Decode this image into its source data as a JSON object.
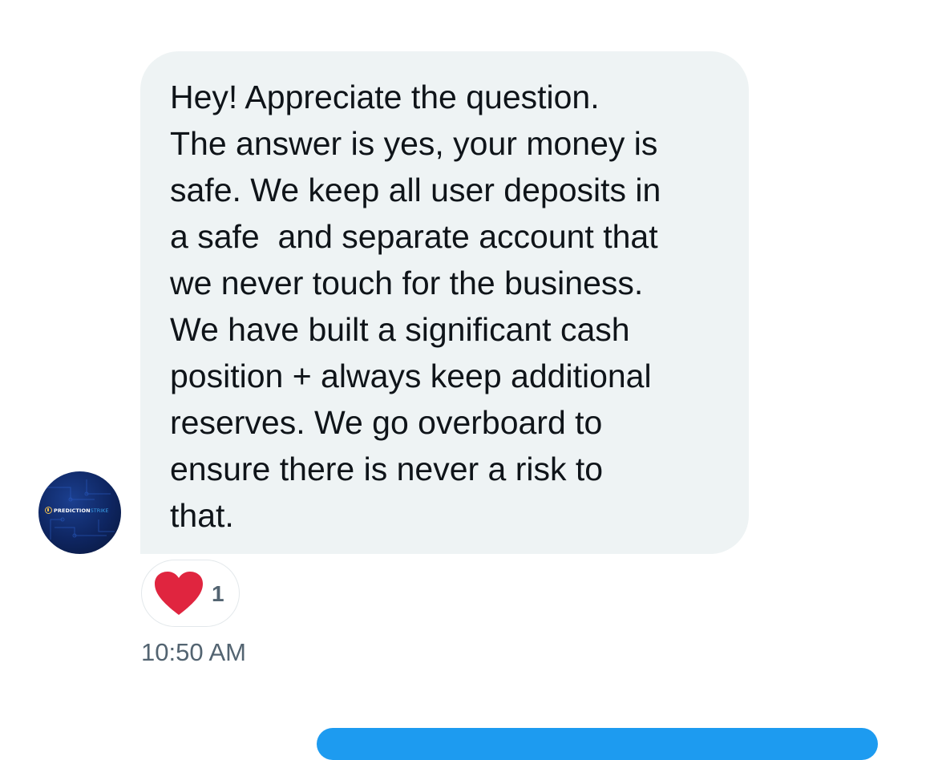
{
  "message": {
    "lines": [
      "Hey! Appreciate the question.",
      "The answer is yes, your money is",
      "safe. We keep all user deposits in",
      "a safe  and separate account that",
      "we never touch for the business.",
      "We have built a significant cash",
      "position + always keep additional",
      "reserves. We go overboard to",
      "ensure there is never a risk to",
      "that."
    ],
    "timestamp": "10:50 AM"
  },
  "avatar": {
    "logo_text_primary": "PREDICTION",
    "logo_text_secondary": "STRIKE"
  },
  "reaction": {
    "icon": "heart-icon",
    "count": "1"
  },
  "colors": {
    "bubble_bg": "#eef3f4",
    "text": "#0f1419",
    "secondary_text": "#536471",
    "heart": "#e0253f",
    "accent_blue": "#1d9bf0"
  }
}
